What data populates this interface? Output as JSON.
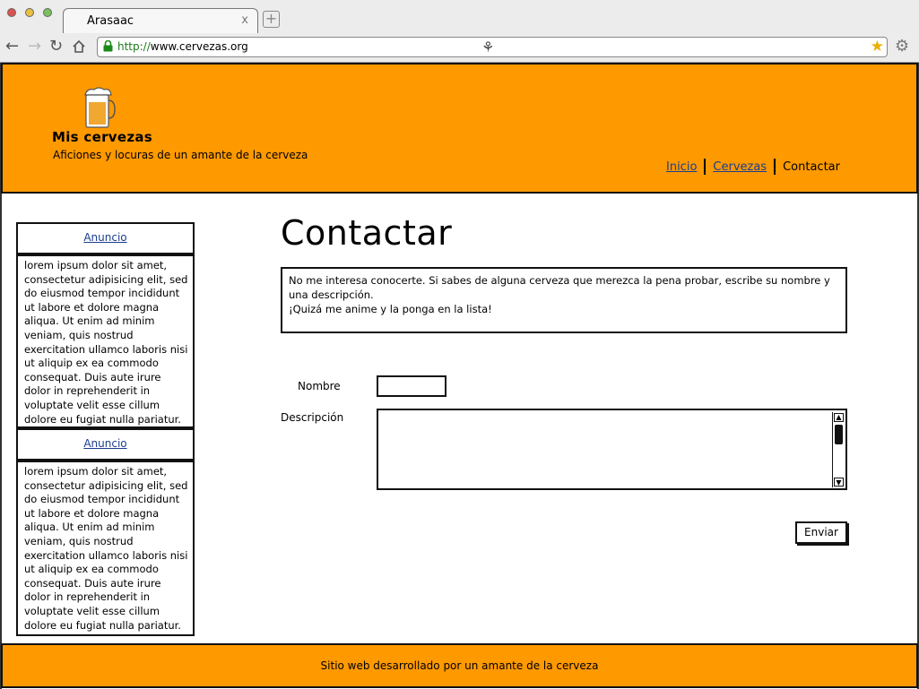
{
  "browser": {
    "tab_title": "Arasaac",
    "tab_close": "x",
    "new_tab": "+",
    "url_protocol": "http://",
    "url_host": "www.cervezas.org",
    "icons": [
      "back-arrow-icon",
      "forward-arrow-icon",
      "reload-icon",
      "home-icon",
      "lock-icon",
      "person-icon",
      "star-icon",
      "gear-icon"
    ]
  },
  "header": {
    "logo_icon": "beer-mug-icon",
    "title": "Mis cervezas",
    "subtitle": "Aficiones y locuras de un amante de la cerveza",
    "nav": [
      {
        "label": "Inicio",
        "link": true
      },
      {
        "label": "Cervezas",
        "link": true
      },
      {
        "label": "Contactar",
        "link": false
      }
    ]
  },
  "sidebar": {
    "ads": [
      {
        "title": "Anuncio",
        "body": "lorem ipsum dolor sit amet, consectetur adipisicing elit, sed do eiusmod tempor incididunt ut labore et dolore magna aliqua. Ut enim ad minim veniam, quis nostrud exercitation ullamco laboris nisi ut aliquip ex ea commodo consequat. Duis aute irure dolor in reprehenderit in voluptate velit esse cillum dolore eu fugiat nulla pariatur."
      },
      {
        "title": "Anuncio",
        "body": "lorem ipsum dolor sit amet, consectetur adipisicing elit, sed do eiusmod tempor incididunt ut labore et dolore magna aliqua. Ut enim ad minim veniam, quis nostrud exercitation ullamco laboris nisi ut aliquip ex ea commodo consequat. Duis aute irure dolor in reprehenderit in voluptate velit esse cillum dolore eu fugiat nulla pariatur."
      }
    ]
  },
  "main": {
    "title": "Contactar",
    "intro_line1": "No me interesa conocerte. Si sabes de alguna cerveza que merezca la pena probar, escribe su nombre y una descripción.",
    "intro_line2": "¡Quizá me anime y la ponga en la lista!",
    "form": {
      "name_label": "Nombre",
      "name_value": "",
      "description_label": "Descripción",
      "description_value": "",
      "submit_label": "Enviar"
    }
  },
  "footer": {
    "text": "Sitio web desarrollado por un amante de la cerveza"
  },
  "colors": {
    "header_bg": "#ff9900",
    "footer_bg": "#ff9900",
    "link": "#1a3d8f"
  }
}
